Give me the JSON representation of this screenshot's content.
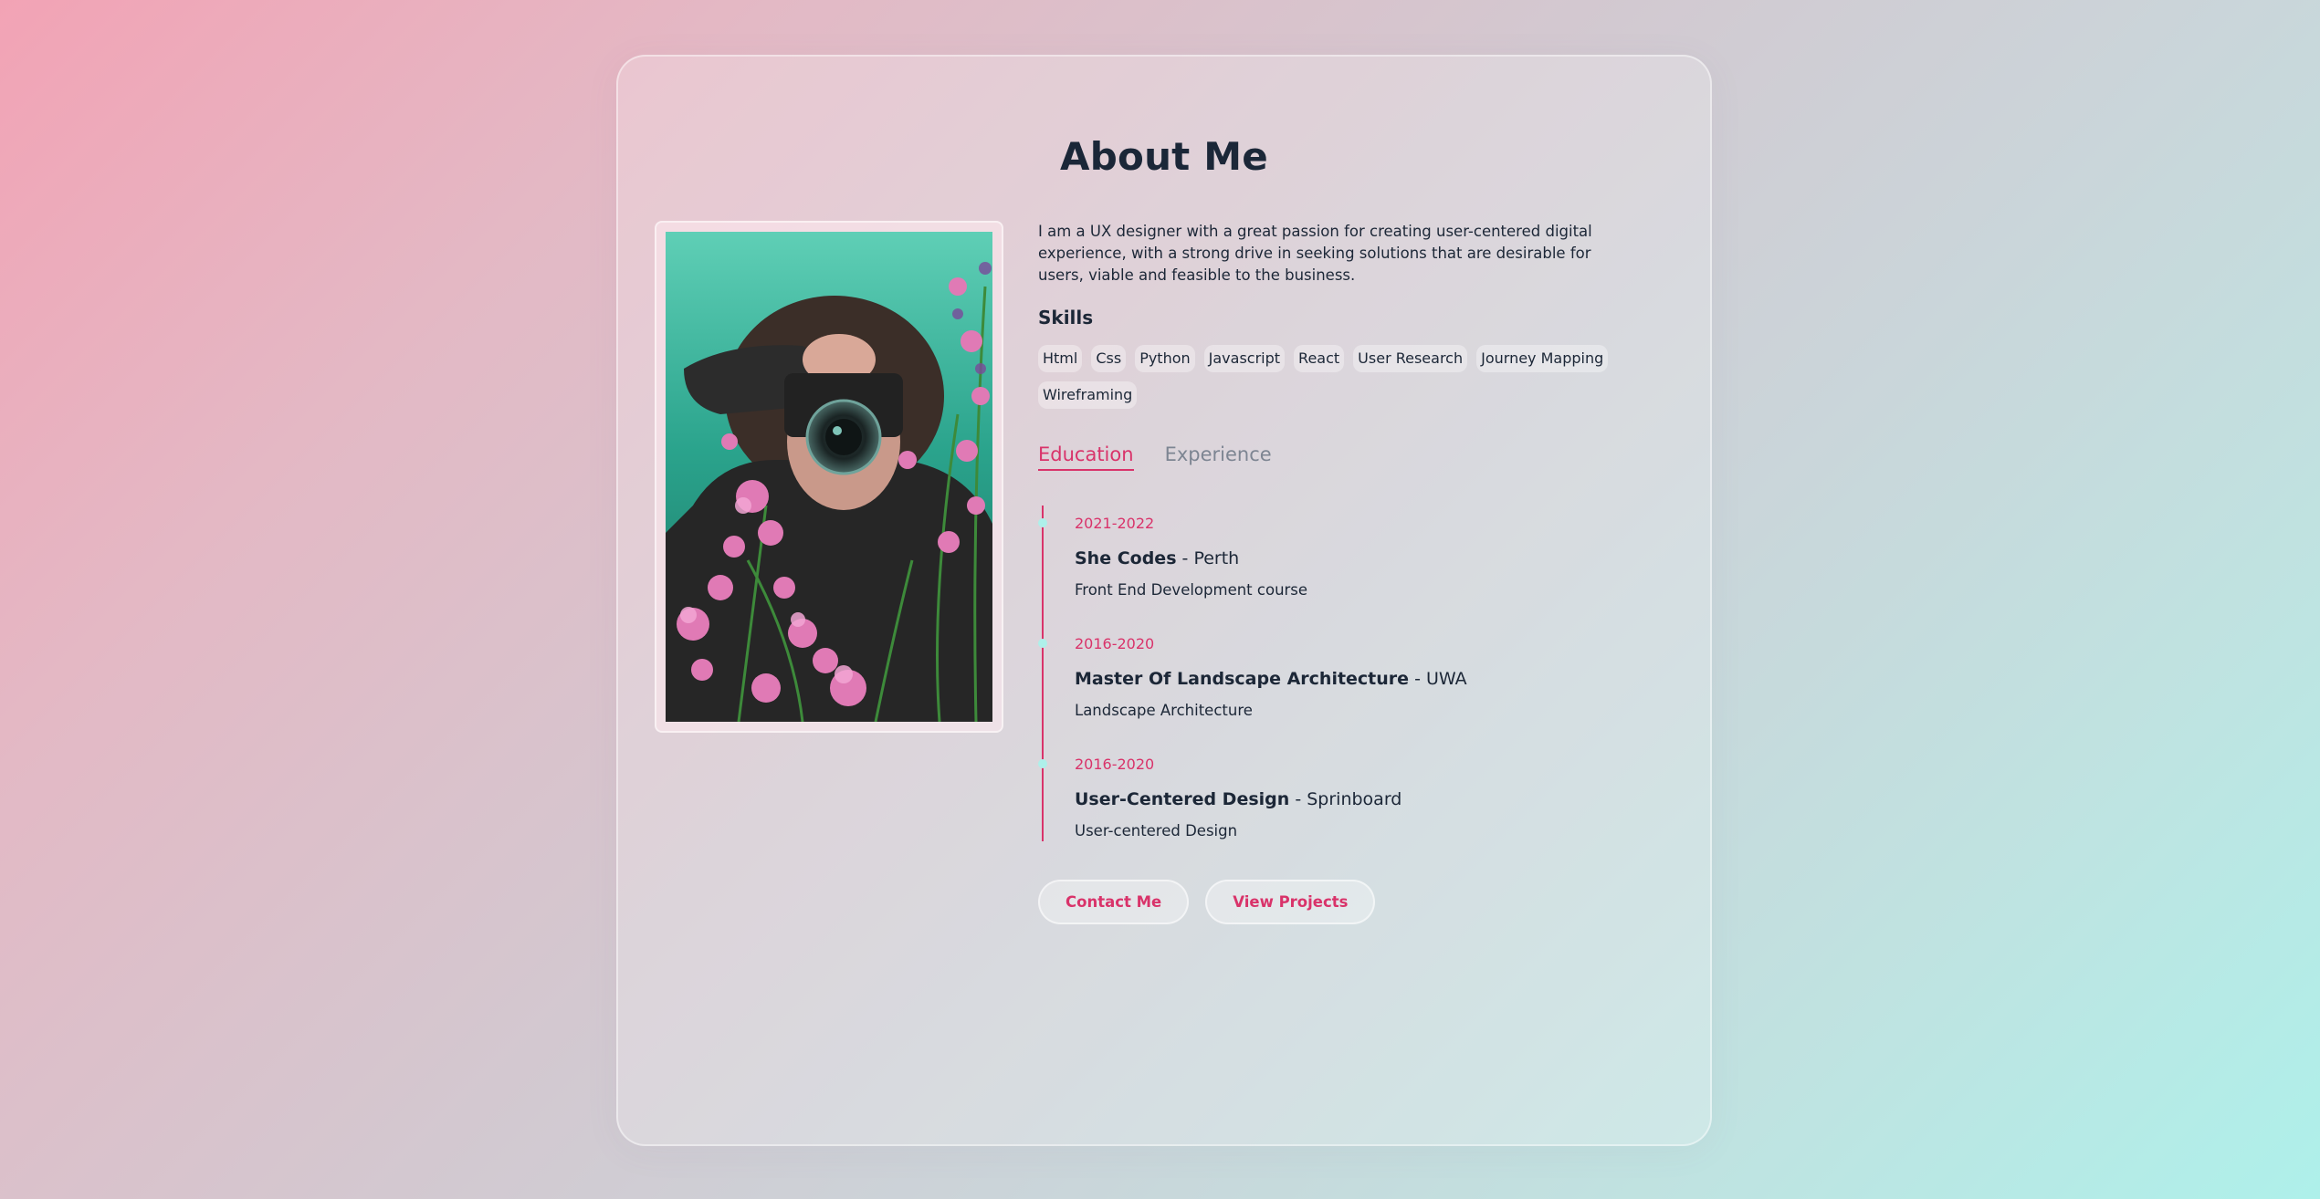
{
  "page": {
    "title": "About Me"
  },
  "about": {
    "bio": "I am a UX designer with a great passion for creating user-centered digital experience, with a strong drive in seeking solutions that are desirable for users, viable and feasible to the business.",
    "skills_heading": "Skills",
    "skills": [
      "Html",
      "Css",
      "Python",
      "Javascript",
      "React",
      "User Research",
      "Journey Mapping",
      "Wireframing"
    ]
  },
  "tabs": [
    {
      "label": "Education",
      "active": true
    },
    {
      "label": "Experience",
      "active": false
    }
  ],
  "education": [
    {
      "date": "2021-2022",
      "title": "She Codes",
      "place": "Perth",
      "desc": "Front End Development course"
    },
    {
      "date": "2016-2020",
      "title": "Master Of Landscape Architecture",
      "place": "UWA",
      "desc": "Landscape Architecture"
    },
    {
      "date": "2016-2020",
      "title": "User-Centered Design",
      "place": "Sprinboard",
      "desc": "User-centered Design"
    }
  ],
  "buttons": {
    "contact": "Contact Me",
    "projects": "View Projects"
  },
  "colors": {
    "accent": "#d9336a",
    "dot": "#aef0ea",
    "text": "#1c2737"
  },
  "photo": {
    "subject": "photographer-with-camera-among-pink-flowers"
  }
}
